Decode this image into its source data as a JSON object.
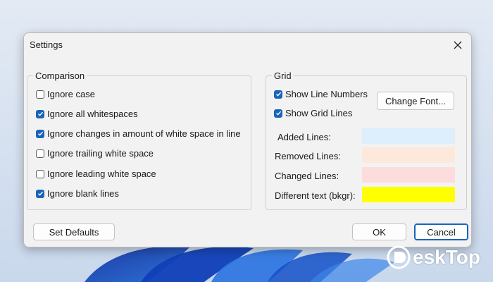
{
  "dialog": {
    "title": "Settings",
    "close_label": "✕"
  },
  "comparison": {
    "label": "Comparison",
    "options": [
      {
        "label": "Ignore case",
        "checked": false
      },
      {
        "label": "Ignore all whitespaces",
        "checked": true
      },
      {
        "label": "Ignore changes in amount of white space in line",
        "checked": true
      },
      {
        "label": "Ignore trailing white space",
        "checked": false
      },
      {
        "label": "Ignore leading white space",
        "checked": false
      },
      {
        "label": "Ignore blank lines",
        "checked": true
      }
    ]
  },
  "grid": {
    "label": "Grid",
    "show_line_numbers": {
      "label": "Show Line Numbers",
      "checked": true
    },
    "show_grid_lines": {
      "label": "Show Grid Lines",
      "checked": true
    },
    "change_font_label": "Change Font...",
    "colors": [
      {
        "label": "Added Lines:",
        "color": "#ddeefd"
      },
      {
        "label": "Removed Lines:",
        "color": "#fde9db"
      },
      {
        "label": "Changed Lines:",
        "color": "#fddcdc"
      },
      {
        "label": "Different text (bkgr):",
        "color": "#ffff00"
      }
    ]
  },
  "buttons": {
    "set_defaults": "Set Defaults",
    "ok": "OK",
    "cancel": "Cancel"
  },
  "watermark": {
    "text": "eskTop",
    "icon": "d-logo-icon"
  }
}
